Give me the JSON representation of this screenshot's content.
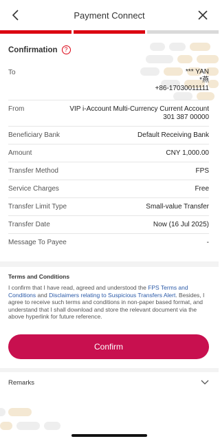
{
  "header": {
    "title": "Payment Connect",
    "back_icon": "chevron-left-icon",
    "close_icon": "close-icon"
  },
  "progress": {
    "steps_total": 3,
    "steps_done": 2,
    "done_color": "#db0011",
    "pending_color": "#d9d9d9"
  },
  "confirmation": {
    "title": "Confirmation",
    "help_symbol": "?",
    "rows": {
      "to": {
        "label": "To",
        "name_line1": "*** YAN",
        "name_line2": "*燕",
        "phone": "+86-17030011111"
      },
      "from": {
        "label": "From",
        "account_name": "VIP i-Account Multi-Currency Current Account",
        "account_number": "301 387 00000"
      },
      "bank": {
        "label": "Beneficiary Bank",
        "value": "Default Receiving Bank"
      },
      "amount": {
        "label": "Amount",
        "value": "CNY 1,000.00"
      },
      "method": {
        "label": "Transfer Method",
        "value": "FPS"
      },
      "charges": {
        "label": "Service Charges",
        "value": "Free"
      },
      "limit": {
        "label": "Transfer Limit Type",
        "value": "Small-value Transfer"
      },
      "date": {
        "label": "Transfer Date",
        "value": "Now (16 Jul 2025)"
      },
      "message": {
        "label": "Message To Payee",
        "value": "-"
      }
    }
  },
  "terms": {
    "title": "Terms and Conditions",
    "text_1": "I confirm that I have read, agreed and understood the ",
    "link_1": "FPS Terms and Conditions",
    "text_2": " and ",
    "link_2": "Disclaimers relating to Suspicious Transfers Alert",
    "text_3": ". Besides, I agree to receive such terms and conditions in non-paper based format, and understand that I shall download and store the relevant document via the above hyperlink for future reference."
  },
  "confirm_button": {
    "label": "Confirm",
    "color": "#c8104f"
  },
  "remarks": {
    "label": "Remarks",
    "icon": "chevron-down-icon"
  },
  "colors": {
    "accent": "#db0011",
    "link": "#2b5aa8",
    "decor": "#f4e8d3"
  }
}
